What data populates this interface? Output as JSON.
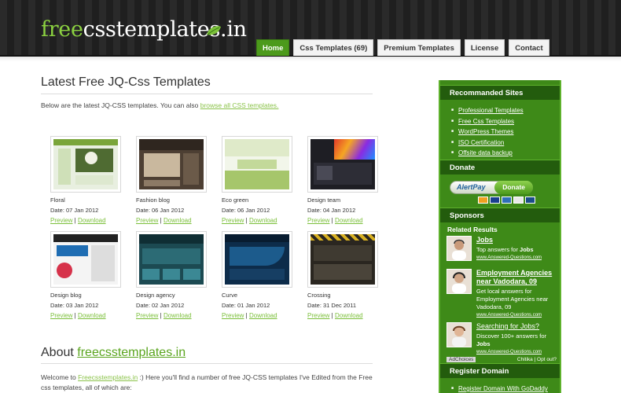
{
  "header": {
    "logo_part1": "free",
    "logo_part2": "csstemplates.in",
    "nav": [
      {
        "label": "Home",
        "active": true
      },
      {
        "label": "Css Templates (69)",
        "active": false
      },
      {
        "label": "Premium Templates",
        "active": false
      },
      {
        "label": "License",
        "active": false
      },
      {
        "label": "Contact",
        "active": false
      }
    ]
  },
  "main": {
    "title": "Latest Free JQ-Css Templates",
    "intro_text": "Below are the latest JQ-CSS templates. You can also",
    "intro_link": "browse all CSS templates.",
    "templates": [
      {
        "name": "Floral",
        "date": "Date: 07 Jan 2012",
        "preview": "Preview",
        "download": "Download"
      },
      {
        "name": "Fashion blog",
        "date": "Date: 06 Jan 2012",
        "preview": "Preview",
        "download": "Download"
      },
      {
        "name": "Eco green",
        "date": "Date: 06 Jan 2012",
        "preview": "Preview",
        "download": "Download"
      },
      {
        "name": "Design team",
        "date": "Date: 04 Jan 2012",
        "preview": "Preview",
        "download": "Download"
      },
      {
        "name": "Design blog",
        "date": "Date: 03 Jan 2012",
        "preview": "Preview",
        "download": "Download"
      },
      {
        "name": "Design agency",
        "date": "Date: 02 Jan 2012",
        "preview": "Preview",
        "download": "Download"
      },
      {
        "name": "Curve",
        "date": "Date: 01 Jan 2012",
        "preview": "Preview",
        "download": "Download"
      },
      {
        "name": "Crossing",
        "date": "Date: 31 Dec 2011",
        "preview": "Preview",
        "download": "Download"
      }
    ],
    "about_title": "About",
    "about_link": "freecsstemplates.in",
    "welcome_pre": "Welcome to",
    "welcome_link": "Freecsstemplates.in",
    "welcome_post": ":) Here you'll find a number of free JQ-CSS templates I've Edited from the Free css templates, all of which are:"
  },
  "sidebar": {
    "recommended_title": "Recommanded Sites",
    "recommended": [
      "Professional Templates",
      "Free Css Templates",
      "WordPress Themes",
      "ISO Certification",
      "Offsite data backup"
    ],
    "donate_title": "Donate",
    "alertpay_label": "AlertPay",
    "donate_button": "Donate",
    "sponsors_title": "Sponsors",
    "related_title": "Related Results",
    "ads": [
      {
        "headline": "Jobs",
        "desc_pre": "Top answers for ",
        "desc_bold": "Jobs",
        "desc_post": "",
        "url": "www.Answered-Questions.com"
      },
      {
        "headline": "Employment Agencies near Vadodara, 09",
        "desc_pre": "Get local answers for Employment Agencies near Vadodara, 09",
        "desc_bold": "",
        "desc_post": "",
        "url": "www.Answered-Questions.com"
      },
      {
        "headline": "Searching for Jobs?",
        "desc_pre": "Discover 100+ answers for ",
        "desc_bold": "Jobs",
        "desc_post": "",
        "url": "www.Answered-Questions.com"
      }
    ],
    "adchoices_label": "AdChoices",
    "adchoices_right": "Chitika | Opt out?",
    "register_title": "Register Domain",
    "register_links": [
      "Register Domain With GoDaddy"
    ]
  }
}
